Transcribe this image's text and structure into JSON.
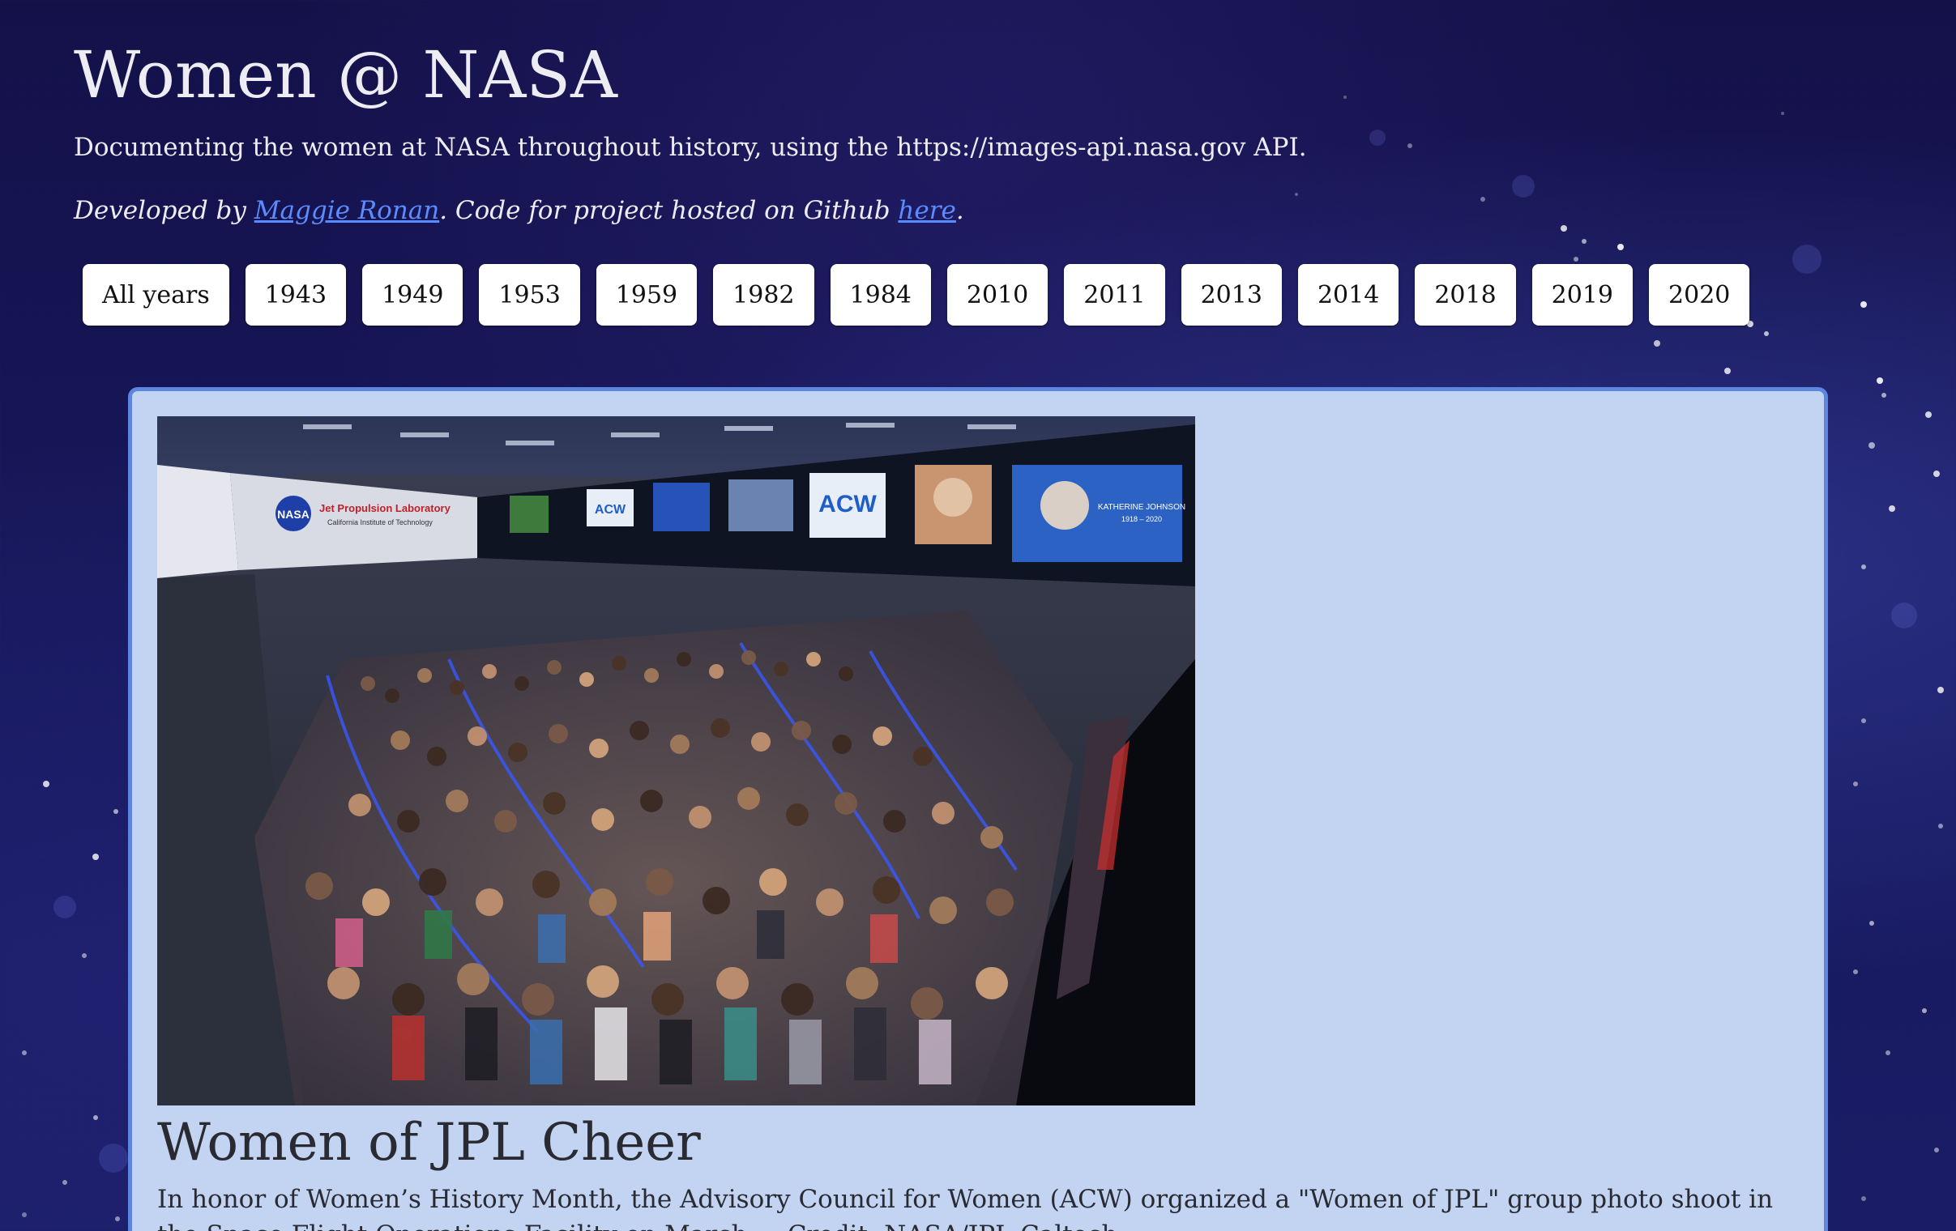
{
  "header": {
    "title": "Women @ NASA",
    "subtitle": "Documenting the women at NASA throughout history, using the https://images-api.nasa.gov API.",
    "credits_prefix": "Developed by ",
    "author_link": "Maggie Ronan",
    "credits_middle": ". Code for project hosted on Github ",
    "github_link": "here",
    "credits_suffix": "."
  },
  "years": {
    "all": "All years",
    "list": [
      "1943",
      "1949",
      "1953",
      "1959",
      "1982",
      "1984",
      "2010",
      "2011",
      "2013",
      "2014",
      "2018",
      "2019",
      "2020"
    ]
  },
  "card": {
    "image_alt": "Women of JPL group photo in the Space Flight Operations Facility",
    "title": "Women of JPL Cheer",
    "description": "In honor of Women’s History Month, the Advisory Council for Women (ACW) organized a \"Women of JPL\" group photo shoot in the Space Flight Operations Facility on March ... Credit: NASA/JPL-Caltech",
    "screen_labels": {
      "nasa": "NASA",
      "jpl": "Jet Propulsion Laboratory",
      "caltech": "California Institute of Technology",
      "acw": "ACW",
      "katherine": "KATHERINE JOHNSON",
      "years": "1918 – 2020"
    }
  },
  "colors": {
    "background": "#17185c",
    "card_bg": "#c2d4f2",
    "card_border": "#5c86e0",
    "link": "#5b8cff",
    "button_bg": "#ffffff"
  }
}
